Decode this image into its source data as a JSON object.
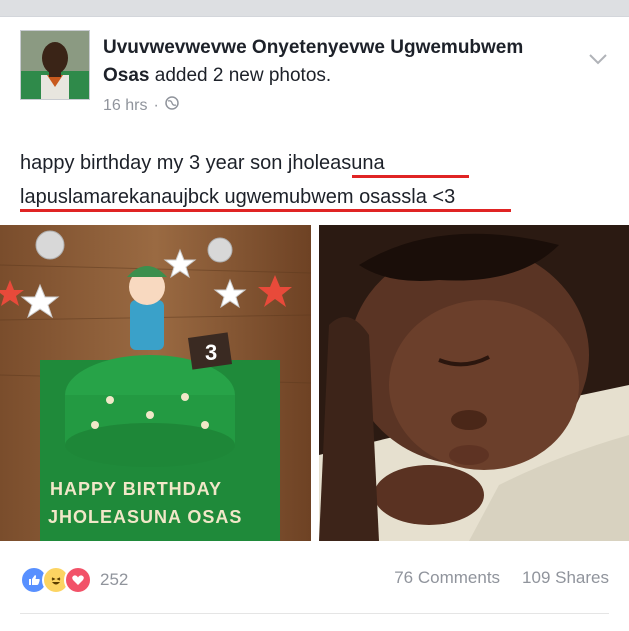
{
  "post": {
    "author_name": "Uvuvwevwevwe Onyetenyevwe Ugwemubwem Osas",
    "action": "added 2 new photos.",
    "time": "16 hrs",
    "text_line1": "happy birthday my 3 year  son jholeasuna",
    "text_line2": "lapuslamarekanaujbck ugwemubwem osassla <3"
  },
  "photos": {
    "cake_line1": "HAPPY BIRTHDAY",
    "cake_line2": "JHOLEASUNA OSAS",
    "cake_topper": "3"
  },
  "footer": {
    "reaction_count": "252",
    "comments": "76 Comments",
    "shares": "109 Shares"
  },
  "colors": {
    "text": "#1d2129",
    "muted": "#90949c",
    "underline": "#e02424",
    "like_blue": "#5890ff",
    "love_red": "#f25268",
    "haha_yellow": "#fcd462"
  },
  "icons": [
    "globe-icon",
    "chevron-down-icon",
    "like-reaction-icon",
    "haha-reaction-icon",
    "love-reaction-icon"
  ]
}
